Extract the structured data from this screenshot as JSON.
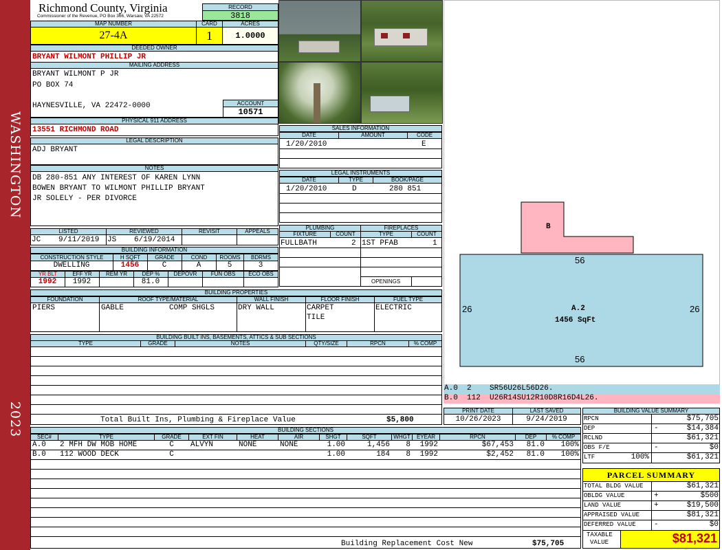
{
  "sidebar": {
    "district": "WASHINGTON",
    "year": "2023"
  },
  "header": {
    "county": "Richmond County, Virginia",
    "commissioner": "Commissioner of the Revenue, PO Box 366, Warsaw, VA 22572",
    "record_label": "RECORD",
    "record": "3818",
    "map_label": "MAP NUMBER",
    "map": "27-4A",
    "card_label": "CARD",
    "card": "1",
    "acres_label": "ACRES",
    "acres": "1.0000"
  },
  "owner": {
    "deeded_label": "DEEDED OWNER",
    "deeded": "BRYANT WILMONT PHILLIP JR",
    "mailing_label": "MAILING ADDRESS",
    "line1": "BRYANT WILMONT P JR",
    "line2": "PO BOX 74",
    "line3": "HAYNESVILLE, VA 22472-0000",
    "account_label": "ACCOUNT",
    "account": "10571",
    "physical_label": "PHYSICAL 911 ADDRESS",
    "physical": "13551 RICHMOND ROAD",
    "legal_label": "LEGAL DESCRIPTION",
    "legal": "ADJ BRYANT",
    "notes_label": "NOTES",
    "notes1": "DB 280-851 ANY INTEREST OF KAREN LYNN",
    "notes2": "BOWEN BRYANT TO WILMONT PHILLIP BRYANT",
    "notes3": "JR SOLELY - PER DIVORCE"
  },
  "photos": [
    "exterior-rear",
    "exterior-front",
    "yard-tree",
    "yard-pool"
  ],
  "sales": {
    "label": "SALES INFORMATION",
    "h_date": "DATE",
    "h_amount": "AMOUNT",
    "h_code": "CODE",
    "date": "1/20/2010",
    "code": "E"
  },
  "legal_instr": {
    "label": "LEGAL INSTRUMENTS",
    "h_date": "DATE",
    "h_type": "TYPE",
    "h_book": "BOOK/PAGE",
    "date": "1/20/2010",
    "type": "D",
    "book": "280 851"
  },
  "review": {
    "h_listed": "LISTED",
    "h_reviewed": "REVIEWED",
    "h_revisit": "REVISIT",
    "h_appeals": "APPEALS",
    "listed_by": "JC",
    "listed": "9/11/2019",
    "reviewed_by": "JS",
    "reviewed": "6/19/2014"
  },
  "building_info": {
    "label": "BUILDING INFORMATION",
    "h_style": "CONSTRUCTION STYLE",
    "h_sqft": "H SQFT",
    "h_grade": "GRADE",
    "h_cond": "COND",
    "h_rooms": "ROOMS",
    "h_bdrms": "BDRMS",
    "style": "DWELLING",
    "sqft": "1456",
    "grade": "C",
    "cond": "A",
    "rooms": "5",
    "bdrms": "3",
    "h_yrblt": "YR BLT",
    "h_effyr": "EFF YR",
    "h_remyr": "REM YR",
    "h_dep": "DEP %",
    "h_depovr": "DEPOVR",
    "h_funobs": "FUN OBS",
    "h_ecoobs": "ECO OBS",
    "yrblt": "1992",
    "effyr": "1992",
    "dep": "81.0"
  },
  "plumbing": {
    "label": "PLUMBING",
    "h_fixture": "FIXTURE",
    "h_count": "COUNT",
    "fixture": "FULLBATH",
    "count": "2"
  },
  "fireplaces": {
    "label": "FIREPLACES",
    "h_type": "TYPE",
    "h_count": "COUNT",
    "type": "1ST PFAB",
    "count": "1",
    "openings_label": "OPENINGS"
  },
  "properties": {
    "label": "BUILDING PROPERTIES",
    "h_foundation": "FOUNDATION",
    "h_roof": "ROOF TYPE/MATERIAL",
    "h_wall": "WALL FINISH",
    "h_floor": "FLOOR FINISH",
    "h_fuel": "FUEL TYPE",
    "foundation": "PIERS",
    "roof_type": "GABLE",
    "roof_mat": "COMP SHGLS",
    "wall": "DRY WALL",
    "floor1": "CARPET",
    "floor2": "TILE",
    "fuel": "ELECTRIC"
  },
  "builtins": {
    "label": "BUILDING BUILT INS, BASEMENTS, ATTICS & SUB SECTIONS",
    "h_type": "TYPE",
    "h_grade": "GRADE",
    "h_notes": "NOTES",
    "h_qty": "QTY/SIZE",
    "h_rpcn": "RPCN",
    "h_comp": "% COMP",
    "total_label": "Total Built Ins, Plumbing & Fireplace Value",
    "total": "$5,800"
  },
  "sketch": {
    "b_label": "B",
    "a_label": "A.2",
    "a_area": "1456 SqFt",
    "top": "56",
    "bottom": "56",
    "left": "26",
    "right": "26",
    "line_a": "A.0  2    SR56U26L56D26.",
    "line_b": "B.0  112  U26R14SU12R10D8R16D4L26."
  },
  "dates": {
    "h_print": "PRINT DATE",
    "h_saved": "LAST SAVED",
    "print": "10/26/2023",
    "saved": "9/24/2019"
  },
  "sections": {
    "label": "BUILDING SECTIONS",
    "headers": [
      "SEC#",
      "TYPE",
      "GRADE",
      "EXT FIN",
      "HEAT",
      "AIR",
      "SHGT",
      "SQFT",
      "WHGT",
      "EYEAR",
      "RPCN",
      "DEP",
      "% COMP"
    ],
    "rows": [
      [
        "A.0",
        "2 MFH DW MOB HOME",
        "C",
        "ALVYN",
        "NONE",
        "NONE",
        "1.00",
        "1,456",
        "8",
        "1992",
        "$67,453",
        "81.0",
        "100%"
      ],
      [
        "B.0",
        "112 WOOD DECK",
        "C",
        "",
        "",
        "",
        "1.00",
        "184",
        "8",
        "1992",
        "$2,452",
        "81.0",
        "100%"
      ]
    ],
    "rcn_label": "Building Replacement Cost New",
    "rcn": "$75,705"
  },
  "value_summary": {
    "label": "BUILDING VALUE SUMMARY",
    "rpcn_label": "RPCN",
    "rpcn": "$75,705",
    "dep_label": "DEP",
    "dep_sign": "-",
    "dep": "$14,384",
    "rclnd_label": "RCLND",
    "rclnd": "$61,321",
    "obs_label": "OBS F/E",
    "obs_sign": "-",
    "obs": "$0",
    "ltr_label": "LTF",
    "ltr_pct": "100%",
    "ltr": "$61,321"
  },
  "parcel": {
    "label": "PARCEL SUMMARY",
    "bldg_label": "TOTAL BLDG VALUE",
    "bldg": "$61,321",
    "obldg_label": "OBLDG VALUE",
    "obldg_sign": "+",
    "obldg": "$500",
    "land_label": "LAND VALUE",
    "land_sign": "+",
    "land": "$19,500",
    "appr_label": "APPRAISED VALUE",
    "appr": "$81,321",
    "def_label": "DEFERRED VALUE",
    "def_sign": "-",
    "def": "$0",
    "tax_label1": "TAXABLE",
    "tax_label2": "VALUE",
    "tax": "$81,321"
  },
  "colors": {
    "sidebar": "#a8262b",
    "header_blue": "#b7dde8",
    "highlight_yellow": "#ffff00",
    "record_green": "#9ae69a",
    "sketch_blue": "#add8e6",
    "sketch_pink": "#ffb6c1"
  }
}
